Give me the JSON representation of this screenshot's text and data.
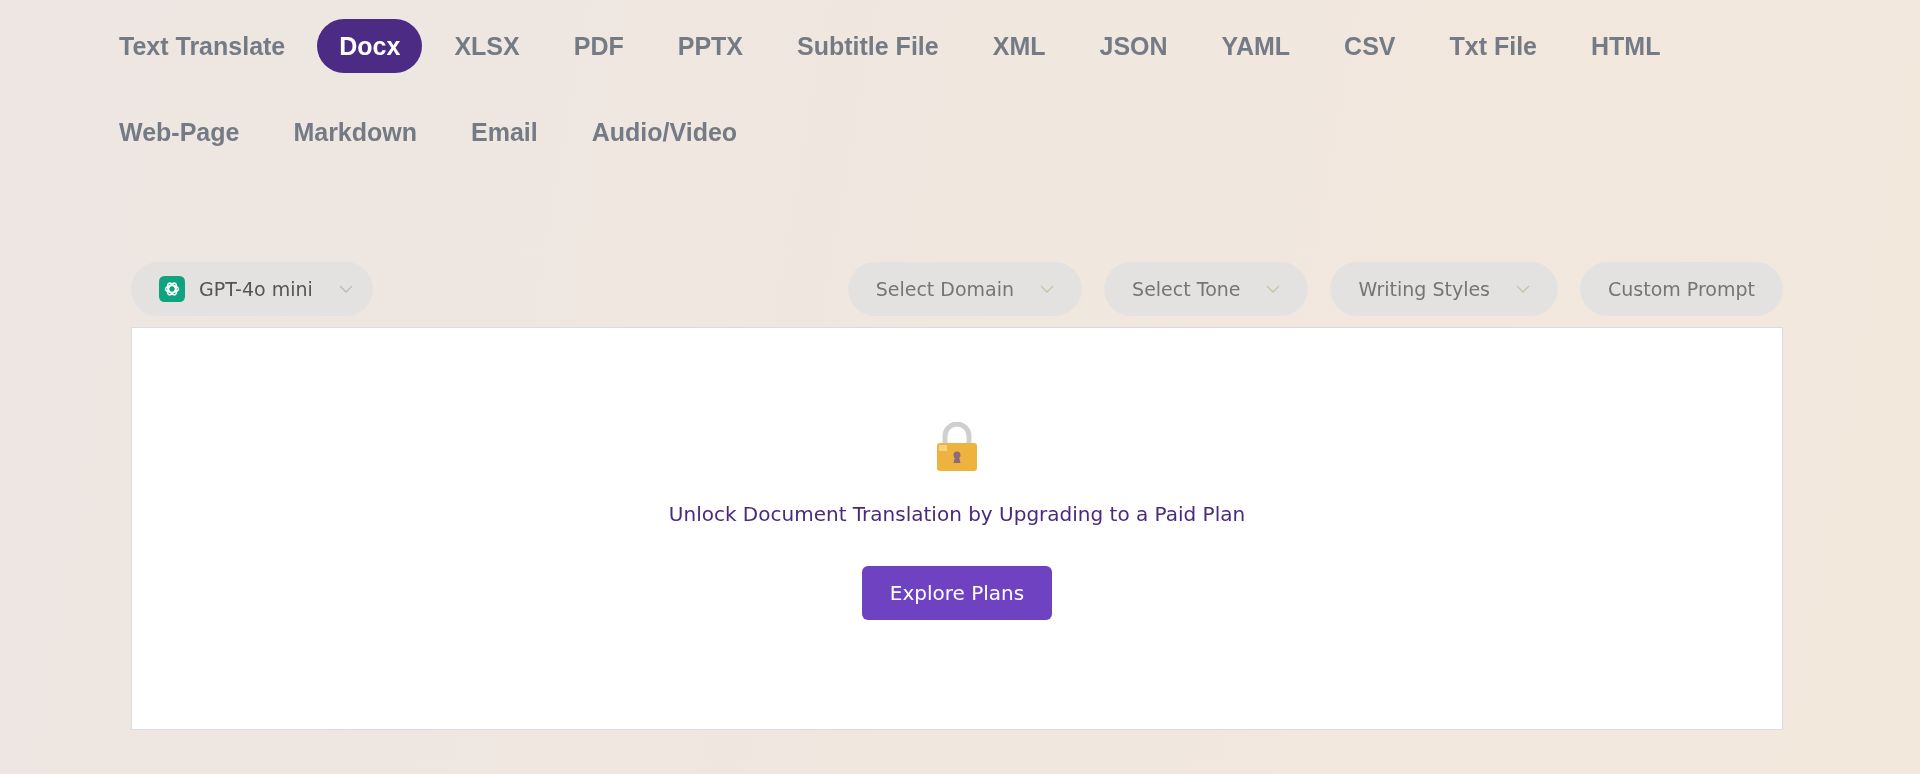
{
  "tabs": [
    {
      "label": "Text Translate",
      "selected": false
    },
    {
      "label": "Docx",
      "selected": true
    },
    {
      "label": "XLSX",
      "selected": false
    },
    {
      "label": "PDF",
      "selected": false
    },
    {
      "label": "PPTX",
      "selected": false
    },
    {
      "label": "Subtitle File",
      "selected": false
    },
    {
      "label": "XML",
      "selected": false
    },
    {
      "label": "JSON",
      "selected": false
    },
    {
      "label": "YAML",
      "selected": false
    },
    {
      "label": "CSV",
      "selected": false
    },
    {
      "label": "Txt File",
      "selected": false
    },
    {
      "label": "HTML",
      "selected": false
    },
    {
      "label": "Web-Page",
      "selected": false
    },
    {
      "label": "Markdown",
      "selected": false
    },
    {
      "label": "Email",
      "selected": false
    },
    {
      "label": "Audio/Video",
      "selected": false
    }
  ],
  "model_select": {
    "label": "GPT-4o mini"
  },
  "options": [
    {
      "label": "Select Domain",
      "kind": "dropdown"
    },
    {
      "label": "Select Tone",
      "kind": "dropdown"
    },
    {
      "label": "Writing Styles",
      "kind": "dropdown"
    },
    {
      "label": "Custom Prompt",
      "kind": "button"
    }
  ],
  "locked_panel": {
    "message": "Unlock Document Translation by Upgrading to a Paid Plan",
    "button": "Explore Plans"
  }
}
